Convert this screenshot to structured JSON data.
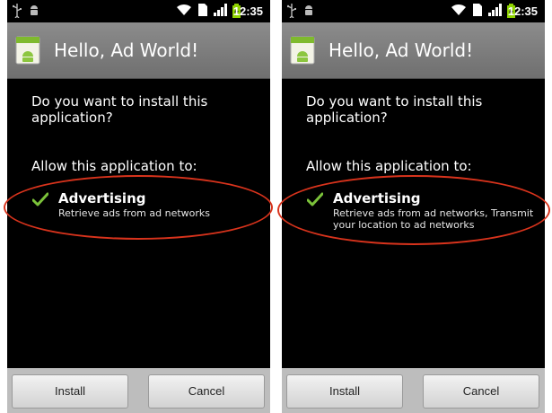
{
  "status_bar": {
    "time": "12:35"
  },
  "screens": [
    {
      "title": "Hello, Ad World!",
      "question": "Do you want to install this application?",
      "allow_heading": "Allow this application to:",
      "permission_title": "Advertising",
      "permission_desc": "Retrieve ads from ad networks",
      "install_label": "Install",
      "cancel_label": "Cancel"
    },
    {
      "title": "Hello, Ad World!",
      "question": "Do you want to install this application?",
      "allow_heading": "Allow this application to:",
      "permission_title": "Advertising",
      "permission_desc": "Retrieve ads from ad networks, Transmit your location to ad networks",
      "install_label": "Install",
      "cancel_label": "Cancel"
    }
  ],
  "icons": [
    "usb-icon",
    "android-debug-icon",
    "wifi-icon",
    "sim-icon",
    "signal-icon",
    "battery-charging-icon",
    "app-icon",
    "check-icon"
  ],
  "colors": {
    "annotation": "#d8331c",
    "check": "#7bc23a",
    "battery": "#8fd400"
  }
}
